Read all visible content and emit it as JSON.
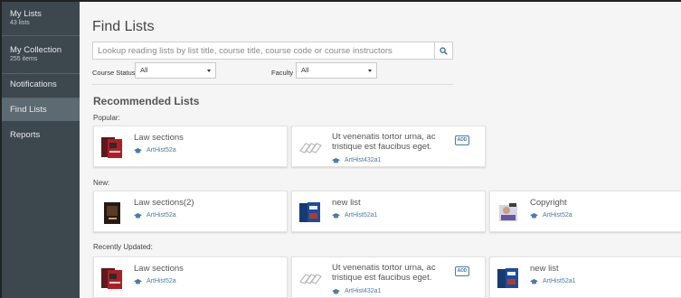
{
  "sidebar": {
    "items": [
      {
        "label": "My Lists",
        "sub": "43 lists"
      },
      {
        "label": "My Collection",
        "sub": "255 items"
      },
      {
        "label": "Notifications"
      },
      {
        "label": "Find Lists"
      },
      {
        "label": "Reports"
      }
    ]
  },
  "page": {
    "title": "Find Lists"
  },
  "search": {
    "placeholder": "Lookup reading lists by list title, course title, course code or course instructors"
  },
  "filters": {
    "course_status_label": "Course Status",
    "course_status_value": "All",
    "faculty_label": "Faculty",
    "faculty_value": "All"
  },
  "recommended": {
    "title": "Recommended Lists",
    "groups": [
      {
        "label": "Popular:",
        "cards": [
          {
            "title": "Law sections",
            "code": "ArtHist52a",
            "add": ""
          },
          {
            "title": "Ut venenatis tortor urna, ac tristique est faucibus eget.",
            "code": "ArtHist432a1",
            "add": "ADD"
          }
        ]
      },
      {
        "label": "New:",
        "cards": [
          {
            "title": "Law sections(2)",
            "code": "ArtHist52a",
            "add": ""
          },
          {
            "title": "new list",
            "code": "ArtHist52a1",
            "add": ""
          },
          {
            "title": "Copyright",
            "code": "ArtHist52a",
            "add": ""
          }
        ]
      },
      {
        "label": "Recently Updated:",
        "cards": [
          {
            "title": "Law sections",
            "code": "ArtHist52a",
            "add": ""
          },
          {
            "title": "Ut venenatis tortor urna, ac tristique est faucibus eget.",
            "code": "ArtHist432a1",
            "add": "ADD"
          },
          {
            "title": "new list",
            "code": "ArtHist52a1",
            "add": ""
          }
        ]
      }
    ]
  },
  "colors": {
    "sidebar": "#3c474e",
    "sidebar_active": "#5e6a71",
    "link": "#4a7aa5"
  }
}
